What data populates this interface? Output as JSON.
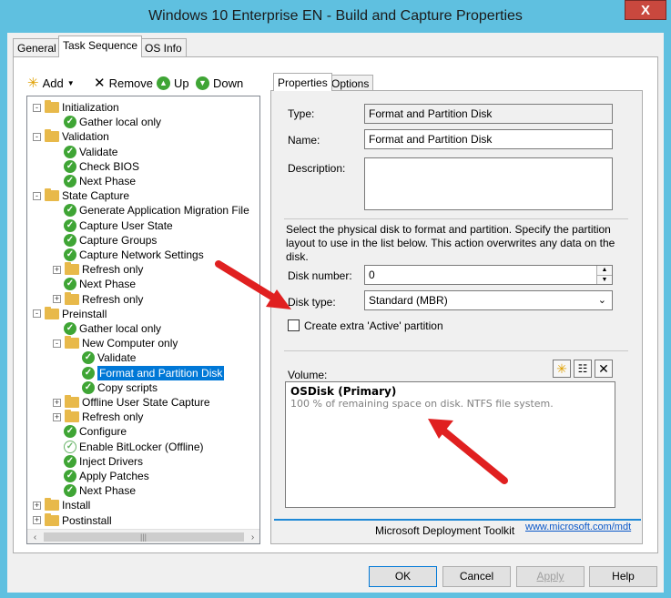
{
  "window": {
    "title": "Windows 10 Enterprise EN - Build and Capture Properties",
    "close_glyph": "X"
  },
  "tabs": [
    {
      "label": "General"
    },
    {
      "label": "Task Sequence"
    },
    {
      "label": "OS Info"
    }
  ],
  "toolbar": {
    "add": "Add",
    "remove": "Remove",
    "up": "Up",
    "down": "Down"
  },
  "tree": [
    {
      "label": "Initialization",
      "type": "group",
      "expander": "-",
      "level": 0
    },
    {
      "label": "Gather local only",
      "type": "step",
      "level": 1
    },
    {
      "label": "Validation",
      "type": "group",
      "expander": "-",
      "level": 0
    },
    {
      "label": "Validate",
      "type": "step",
      "level": 1
    },
    {
      "label": "Check BIOS",
      "type": "step",
      "level": 1
    },
    {
      "label": "Next Phase",
      "type": "step",
      "level": 1
    },
    {
      "label": "State Capture",
      "type": "group",
      "expander": "-",
      "level": 0
    },
    {
      "label": "Generate Application Migration File",
      "type": "step",
      "level": 1
    },
    {
      "label": "Capture User State",
      "type": "step",
      "level": 1
    },
    {
      "label": "Capture Groups",
      "type": "step",
      "level": 1
    },
    {
      "label": "Capture Network Settings",
      "type": "step",
      "level": 1
    },
    {
      "label": "Refresh only",
      "type": "group",
      "expander": "+",
      "level": 1
    },
    {
      "label": "Next Phase",
      "type": "step",
      "level": 1
    },
    {
      "label": "Refresh only",
      "type": "group",
      "expander": "+",
      "level": 1
    },
    {
      "label": "Preinstall",
      "type": "group",
      "expander": "-",
      "level": 0
    },
    {
      "label": "Gather local only",
      "type": "step",
      "level": 1
    },
    {
      "label": "New Computer only",
      "type": "group",
      "expander": "-",
      "level": 1
    },
    {
      "label": "Validate",
      "type": "step",
      "level": 2
    },
    {
      "label": "Format and Partition Disk",
      "type": "step",
      "level": 2,
      "selected": true
    },
    {
      "label": "Copy scripts",
      "type": "step",
      "level": 2
    },
    {
      "label": "Offline User State Capture",
      "type": "group",
      "expander": "+",
      "level": 1
    },
    {
      "label": "Refresh only",
      "type": "group",
      "expander": "+",
      "level": 1
    },
    {
      "label": "Configure",
      "type": "step",
      "level": 1
    },
    {
      "label": "Enable BitLocker (Offline)",
      "type": "step-disabled",
      "level": 1
    },
    {
      "label": "Inject Drivers",
      "type": "step",
      "level": 1
    },
    {
      "label": "Apply Patches",
      "type": "step",
      "level": 1
    },
    {
      "label": "Next Phase",
      "type": "step",
      "level": 1
    },
    {
      "label": "Install",
      "type": "group",
      "expander": "+",
      "level": 0
    },
    {
      "label": "Postinstall",
      "type": "group",
      "expander": "+",
      "level": 0
    }
  ],
  "properties": {
    "tabs": [
      "Properties",
      "Options"
    ],
    "type_label": "Type:",
    "type_value": "Format and Partition Disk",
    "name_label": "Name:",
    "name_value": "Format and Partition Disk",
    "description_label": "Description:",
    "description_value": "",
    "help_text": "Select the physical disk to format and partition.  Specify the partition layout to use in the list below. This action overwrites any data on the disk.",
    "disk_number_label": "Disk number:",
    "disk_number_value": "0",
    "disk_type_label": "Disk type:",
    "disk_type_value": "Standard (MBR)",
    "extra_active_label": "Create extra 'Active' partition",
    "volume_label": "Volume:",
    "volume_title": "OSDisk (Primary)",
    "volume_detail": "100 % of remaining space on disk. NTFS file system.",
    "mdt_label": "Microsoft Deployment Toolkit",
    "mdt_link": "www.microsoft.com/mdt"
  },
  "buttons": {
    "ok": "OK",
    "cancel": "Cancel",
    "apply": "Apply",
    "help": "Help"
  },
  "colors": {
    "titlebar": "#5fc0e0",
    "selection": "#0078d7",
    "check_green": "#3fa535",
    "arrow_red": "#e02020"
  }
}
